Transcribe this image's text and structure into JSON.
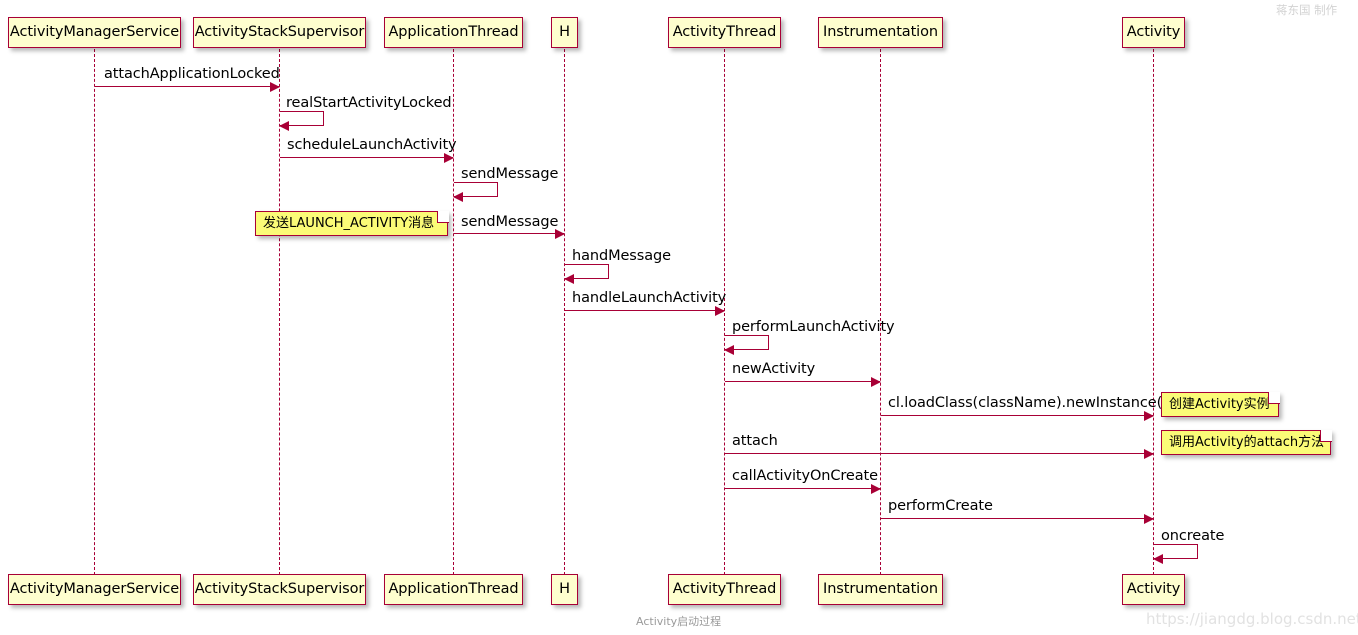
{
  "diagram": {
    "title": "Activity启动过程",
    "watermark_author": "蒋东国 制作",
    "watermark_url": "https://jiangdg.blog.csdn.net",
    "colors": {
      "border": "#A80036",
      "participant_fill": "#FEFECE",
      "note_fill": "#FBFB77",
      "background": "#FFFFFF",
      "text": "#000000"
    }
  },
  "participants": [
    {
      "id": "ams",
      "label": "ActivityManagerService"
    },
    {
      "id": "ass",
      "label": "ActivityStackSupervisor"
    },
    {
      "id": "appt",
      "label": "ApplicationThread"
    },
    {
      "id": "h",
      "label": "H"
    },
    {
      "id": "at",
      "label": "ActivityThread"
    },
    {
      "id": "inst",
      "label": "Instrumentation"
    },
    {
      "id": "act",
      "label": "Activity"
    }
  ],
  "messages": [
    {
      "label": "attachApplicationLocked",
      "from": "ams",
      "to": "ass",
      "kind": "call"
    },
    {
      "label": "realStartActivityLocked",
      "from": "ass",
      "to": "ass",
      "kind": "self"
    },
    {
      "label": "scheduleLaunchActivity",
      "from": "ass",
      "to": "appt",
      "kind": "call"
    },
    {
      "label": "sendMessage",
      "from": "appt",
      "to": "appt",
      "kind": "self"
    },
    {
      "label": "sendMessage",
      "from": "appt",
      "to": "h",
      "kind": "call"
    },
    {
      "label": "handMessage",
      "from": "h",
      "to": "h",
      "kind": "self"
    },
    {
      "label": "handleLaunchActivity",
      "from": "h",
      "to": "at",
      "kind": "call"
    },
    {
      "label": "performLaunchActivity",
      "from": "at",
      "to": "at",
      "kind": "self"
    },
    {
      "label": "newActivity",
      "from": "at",
      "to": "inst",
      "kind": "call"
    },
    {
      "label": "cl.loadClass(className).newInstance()",
      "from": "inst",
      "to": "act",
      "kind": "call"
    },
    {
      "label": "attach",
      "from": "at",
      "to": "act",
      "kind": "call"
    },
    {
      "label": "callActivityOnCreate",
      "from": "at",
      "to": "inst",
      "kind": "call"
    },
    {
      "label": "performCreate",
      "from": "inst",
      "to": "act",
      "kind": "call"
    },
    {
      "label": "oncreate",
      "from": "act",
      "to": "act",
      "kind": "self"
    }
  ],
  "notes": [
    {
      "id": "note-launch-activity",
      "label": "发送LAUNCH_ACTIVITY消息"
    },
    {
      "id": "note-create-instance",
      "label": "创建Activity实例"
    },
    {
      "id": "note-call-attach",
      "label": "调用Activity的attach方法"
    }
  ]
}
